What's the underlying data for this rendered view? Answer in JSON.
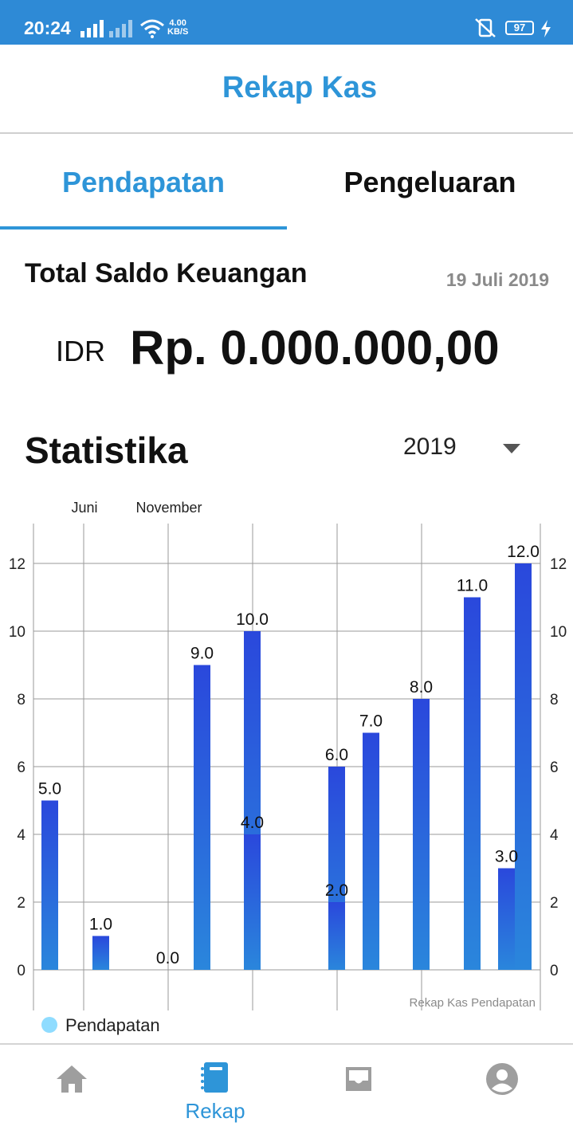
{
  "status_bar": {
    "time": "20:24",
    "speed_value": "4.00",
    "speed_unit": "KB/S",
    "battery": "97",
    "bg_color": "#2e8ad6"
  },
  "header": {
    "title": "Rekap Kas"
  },
  "tabs": [
    {
      "label": "Pendapatan",
      "active": true
    },
    {
      "label": "Pengeluaran",
      "active": false
    }
  ],
  "saldo": {
    "label": "Total Saldo Keuangan",
    "date": "19 Juli 2019",
    "currency": "IDR",
    "amount": "Rp. 0.000.000,00"
  },
  "statistik": {
    "title": "Statistika",
    "year": "2019",
    "year_icon": "dropdown-caret-icon"
  },
  "chart_data": {
    "type": "bar",
    "top_labels": [
      "Juni",
      "November"
    ],
    "yticks": [
      "0",
      "2",
      "4",
      "6",
      "8",
      "10",
      "12"
    ],
    "ylim": [
      0,
      13.2
    ],
    "grid": true,
    "description": "Rekap Kas Pendapatan",
    "legend": "Pendapatan",
    "legend_position": "bottom-left",
    "bar_color_top": "#2a48dc",
    "bar_color_bottom": "#2a86dc",
    "values": [
      5.0,
      1.0,
      0.0,
      9.0,
      10.0,
      4.0,
      6.0,
      2.0,
      7.0,
      8.0,
      11.0,
      3.0,
      12.0
    ],
    "labels": [
      "5.0",
      "1.0",
      "0.0",
      "9.0",
      "10.0",
      "4.0",
      "6.0",
      "2.0",
      "7.0",
      "8.0",
      "11.0",
      "3.0",
      "12.0"
    ]
  },
  "bottom_nav": [
    {
      "icon": "home-icon",
      "label": "",
      "active": false
    },
    {
      "icon": "notebook-icon",
      "label": "Rekap",
      "active": true
    },
    {
      "icon": "inbox-icon",
      "label": "",
      "active": false
    },
    {
      "icon": "account-icon",
      "label": "",
      "active": false
    }
  ],
  "colors": {
    "accent": "#2e95d8",
    "inactive_icon": "#9e9e9e"
  }
}
